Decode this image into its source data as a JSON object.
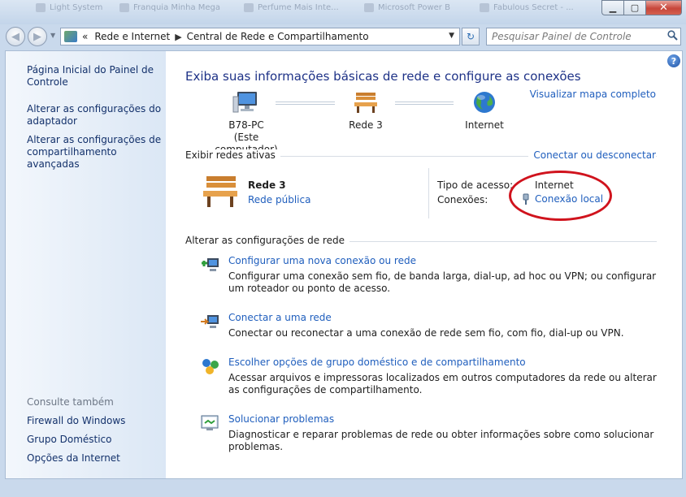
{
  "titlebar": {
    "ghost_tabs": [
      "Light System",
      "Franquia Minha Mega",
      "Perfume Mais Inte...",
      "Microsoft Power B",
      "Fabulous Secret - ..."
    ],
    "minimize_glyph": "▁",
    "maximize_glyph": "▢",
    "close_glyph": "✕"
  },
  "navbar": {
    "back_glyph": "◀",
    "forward_glyph": "▶",
    "history_glyph": "▼",
    "breadcrumb_prefix": "«",
    "breadcrumb": [
      "Rede e Internet",
      "Central de Rede e Compartilhamento"
    ],
    "breadcrumb_sep": "▶",
    "dropdown_glyph": "▼",
    "refresh_glyph": "↻",
    "search_placeholder": "Pesquisar Painel de Controle",
    "search_icon": "magnifier-icon"
  },
  "help_glyph": "?",
  "sidebar": {
    "links": [
      "Página Inicial do Painel de Controle",
      "Alterar as configurações do adaptador",
      "Alterar as configurações de compartilhamento avançadas"
    ],
    "see_also_title": "Consulte também",
    "see_also": [
      "Firewall do Windows",
      "Grupo Doméstico",
      "Opções da Internet"
    ]
  },
  "main": {
    "title": "Exiba suas informações básicas de rede e configure as conexões",
    "view_full_map": "Visualizar mapa completo",
    "map": {
      "computer_name": "B78-PC",
      "computer_sub": "(Este computador)",
      "network": "Rede  3",
      "internet": "Internet"
    },
    "active_networks_title": "Exibir redes ativas",
    "connect_disconnect": "Conectar ou desconectar",
    "active_network": {
      "name": "Rede  3",
      "type": "Rede pública",
      "access_type_label": "Tipo de acesso:",
      "access_type_value": "Internet",
      "connections_label": "Conexões:",
      "connection_value": "Conexão local"
    },
    "change_settings_title": "Alterar as configurações de rede",
    "tasks": [
      {
        "icon": "new-connection-icon",
        "link": "Configurar uma nova conexão ou rede",
        "desc": "Configurar uma conexão sem fio, de banda larga, dial-up, ad hoc ou VPN; ou configurar um roteador ou ponto de acesso."
      },
      {
        "icon": "connect-network-icon",
        "link": "Conectar a uma rede",
        "desc": "Conectar ou reconectar a uma conexão de rede sem fio, com fio, dial-up ou VPN."
      },
      {
        "icon": "homegroup-icon",
        "link": "Escolher opções de grupo doméstico e de compartilhamento",
        "desc": "Acessar arquivos e impressoras localizados em outros computadores da rede ou alterar as configurações de compartilhamento."
      },
      {
        "icon": "troubleshoot-icon",
        "link": "Solucionar problemas",
        "desc": "Diagnosticar e reparar problemas de rede ou obter informações sobre como solucionar problemas."
      }
    ]
  }
}
